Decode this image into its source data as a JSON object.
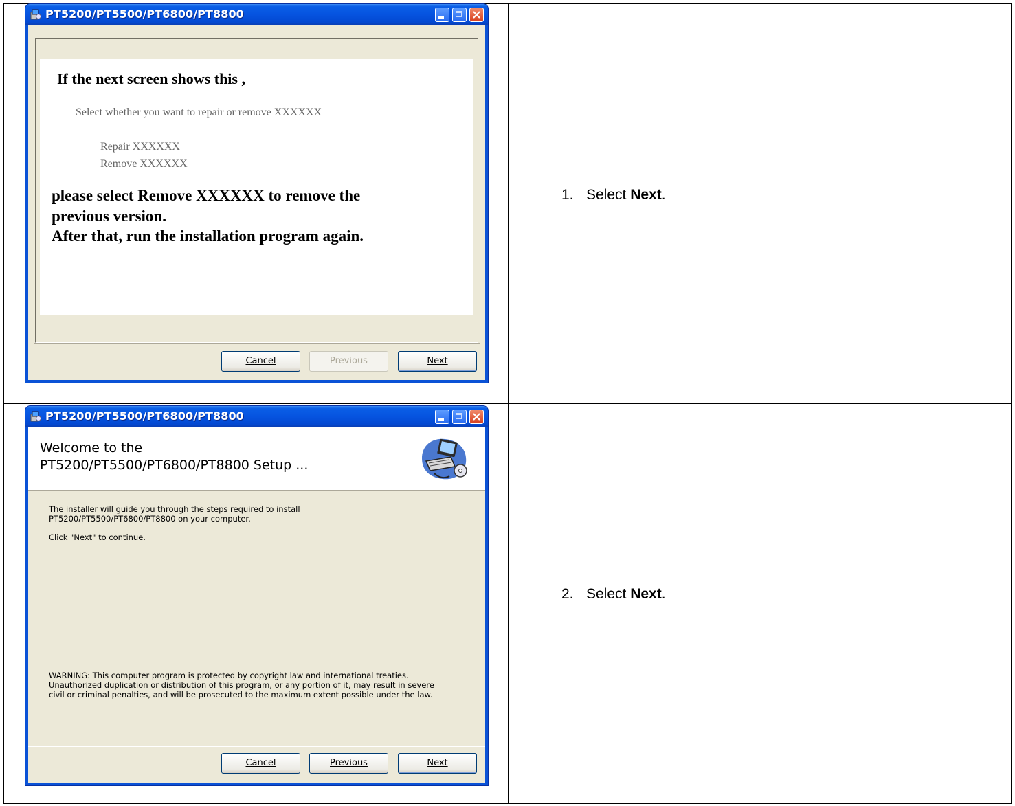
{
  "steps": [
    {
      "number": "1.",
      "text_before": "Select ",
      "bold": "Next",
      "text_after": ".",
      "window": {
        "title": "PT5200/PT5500/PT6800/PT8800",
        "image_heading": "If the next screen shows this ,",
        "image_prompt": "Select whether you want to repair or remove XXXXXX",
        "image_option1": "Repair XXXXXX",
        "image_option2": "Remove XXXXXX",
        "image_instr1": "please select Remove XXXXXX to remove the",
        "image_instr2": "previous version.",
        "image_instr3": "After that, run the installation program again.",
        "buttons": {
          "cancel": "Cancel",
          "previous": "Previous",
          "next": "Next"
        }
      }
    },
    {
      "number": "2.",
      "text_before": "Select ",
      "bold": "Next",
      "text_after": ".",
      "window": {
        "title": "PT5200/PT5500/PT6800/PT8800",
        "header_line1": "Welcome to the",
        "header_line2": "PT5200/PT5500/PT6800/PT8800 Setup ...",
        "body_line1": "The installer will guide you through the steps required to install",
        "body_line2": "PT5200/PT5500/PT6800/PT8800 on your computer.",
        "body_click": "Click \"Next\" to continue.",
        "warning1": "WARNING: This computer program is protected by copyright law and international treaties.",
        "warning2": "Unauthorized duplication or distribution of this program, or any portion of it, may result in severe",
        "warning3": "civil or criminal penalties, and will be prosecuted to the maximum extent possible under the law.",
        "buttons": {
          "cancel": "Cancel",
          "previous": "Previous",
          "next": "Next"
        }
      }
    }
  ],
  "icons": [
    "installer-icon",
    "minimize-icon",
    "maximize-icon",
    "close-icon",
    "computer-setup-icon"
  ],
  "colors": {
    "titlebar": "#0654e0",
    "window_face": "#ece9d8",
    "close_button": "#d8401e"
  }
}
